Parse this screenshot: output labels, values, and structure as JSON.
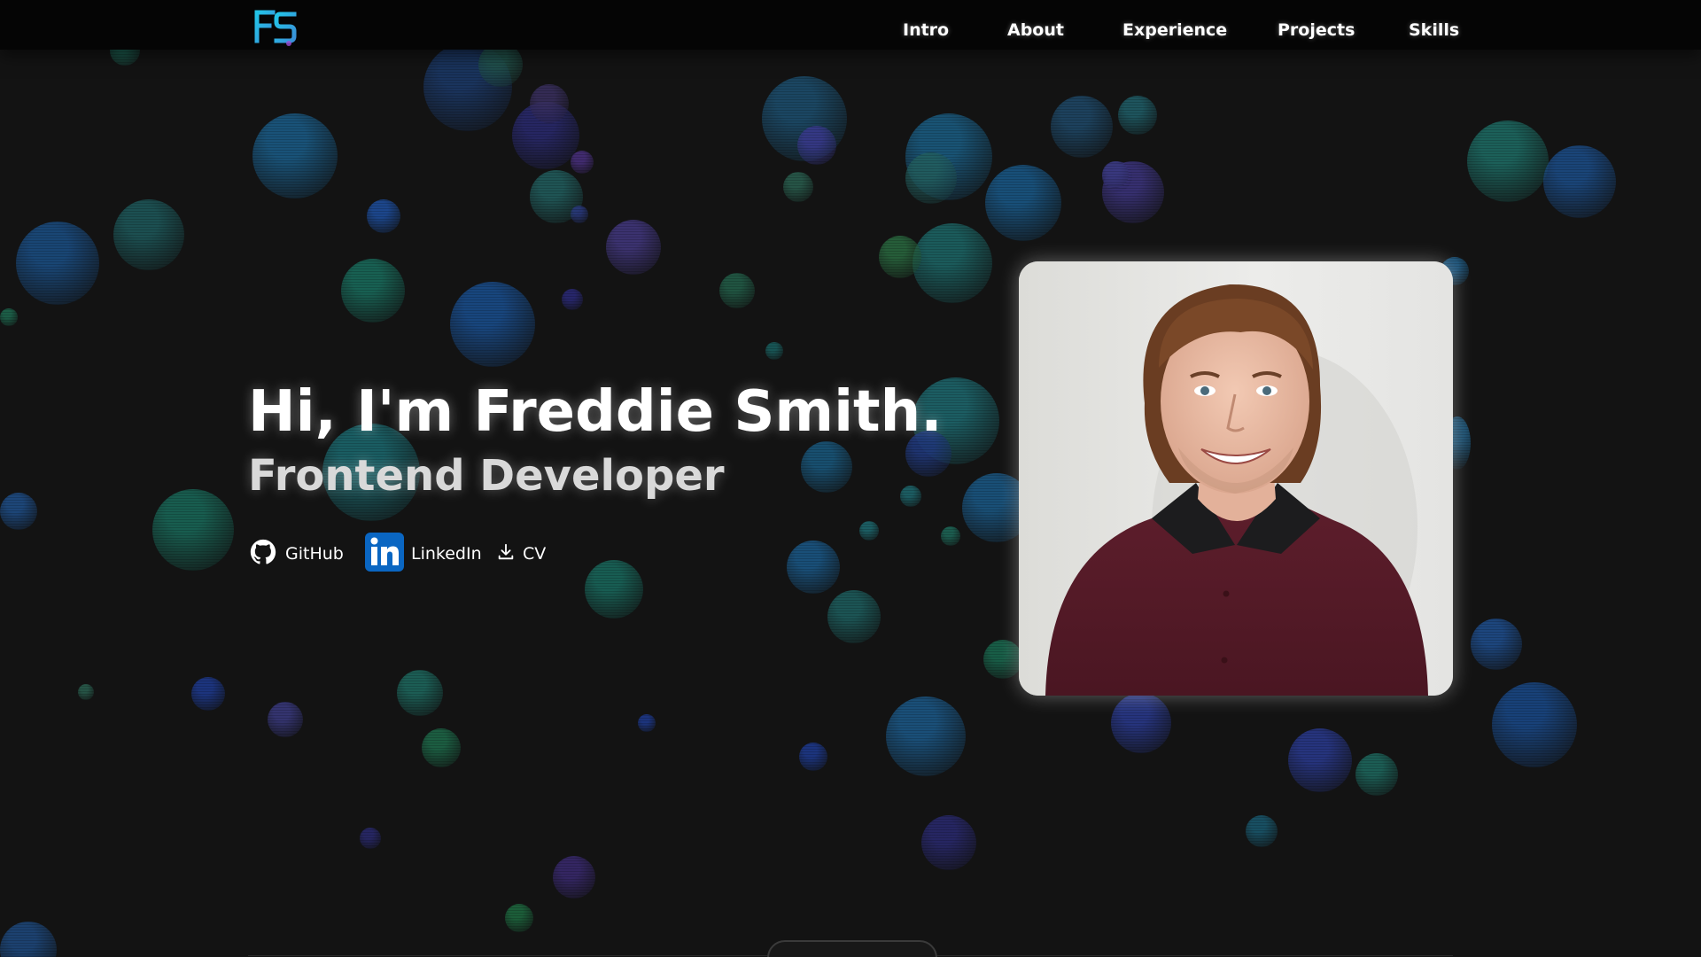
{
  "navbar": {
    "logo_text": "FS",
    "links": [
      {
        "label": "Intro"
      },
      {
        "label": "About"
      },
      {
        "label": "Experience"
      },
      {
        "label": "Projects"
      },
      {
        "label": "Skills"
      }
    ]
  },
  "hero": {
    "title": "Hi, I'm Freddie Smith.",
    "subtitle": "Frontend Developer"
  },
  "social": {
    "github_label": "GitHub",
    "linkedin_label": "LinkedIn",
    "cv_label": "CV",
    "github_icon": "github-icon",
    "linkedin_icon": "linkedin-icon",
    "download_icon": "download-icon"
  },
  "colors": {
    "background": "#131313",
    "navbar": "#050505",
    "logo_cyan": "#22c5e8",
    "linkedin_blue": "#0a66c2",
    "bubble_teal": "#1f6e6a",
    "bubble_blue": "#1d4f8f",
    "bubble_purple": "#4a3a8a"
  }
}
